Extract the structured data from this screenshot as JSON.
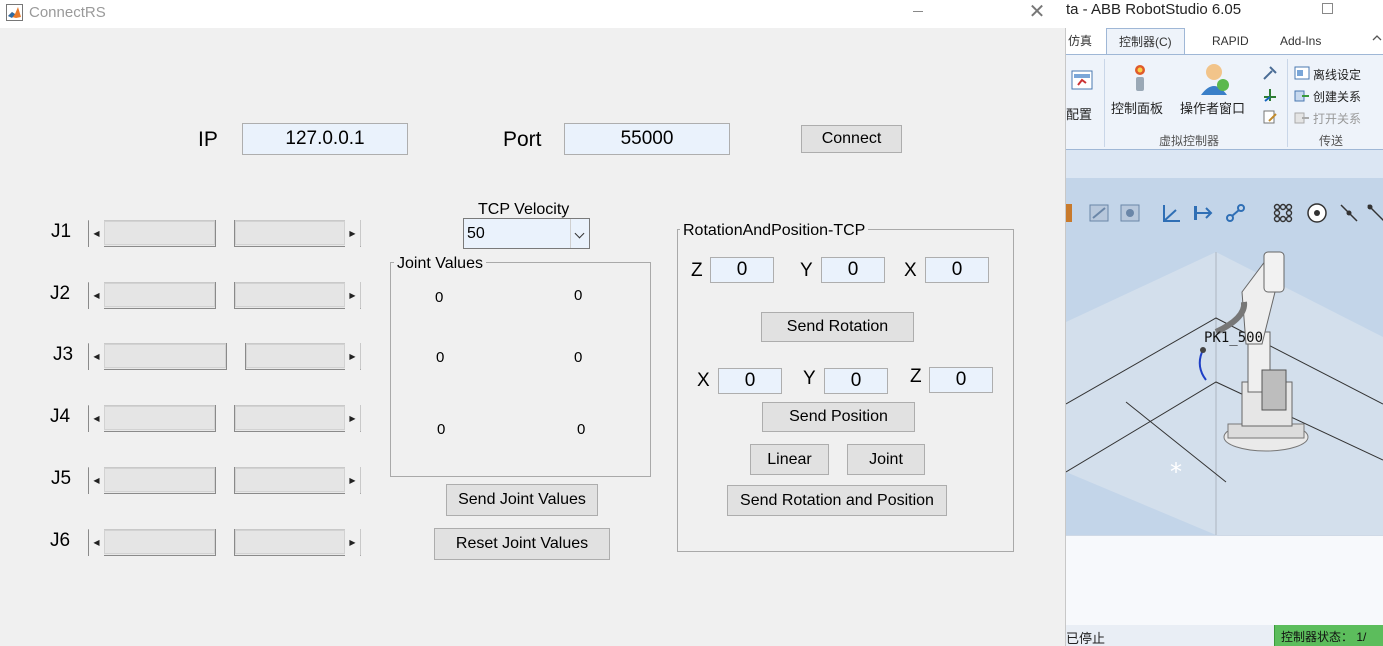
{
  "app": {
    "title": "ConnectRS",
    "close_glyph": "✕"
  },
  "connection": {
    "ip_label": "IP",
    "ip_value": "127.0.0.1",
    "port_label": "Port",
    "port_value": "55000",
    "connect_label": "Connect"
  },
  "joints": [
    {
      "label": "J1",
      "value": 0.5
    },
    {
      "label": "J2",
      "value": 0.5
    },
    {
      "label": "J3",
      "value": 0.55
    },
    {
      "label": "J4",
      "value": 0.5
    },
    {
      "label": "J5",
      "value": 0.5
    },
    {
      "label": "J6",
      "value": 0.5
    }
  ],
  "velocity": {
    "label": "TCP Velocity",
    "selected": "50"
  },
  "joint_values": {
    "title": "Joint Values",
    "values": [
      "0",
      "0",
      "0",
      "0",
      "0",
      "0"
    ],
    "send_label": "Send Joint Values",
    "reset_label": "Reset Joint Values"
  },
  "tcp": {
    "title": "RotationAndPosition-TCP",
    "rotation": {
      "z_label": "Z",
      "z_value": "0",
      "y_label": "Y",
      "y_value": "0",
      "x_label": "X",
      "x_value": "0"
    },
    "send_rotation_label": "Send Rotation",
    "position": {
      "x_label": "X",
      "x_value": "0",
      "y_label": "Y",
      "y_value": "0",
      "z_label": "Z",
      "z_value": "0"
    },
    "send_position_label": "Send Position",
    "linear_label": "Linear",
    "joint_label": "Joint",
    "send_both_label": "Send Rotation and Position"
  },
  "robotstudio": {
    "title": "ta - ABB RobotStudio 6.05",
    "tabs": [
      "仿真",
      "控制器(C)",
      "RAPID",
      "Add-Ins"
    ],
    "active_tab": "控制器(C)",
    "ribbon": {
      "config_label": "配置",
      "control_panel_label": "控制面板",
      "operator_window_label": "操作者窗口",
      "offline_settings_label": "离线设定",
      "create_relation_label": "创建关系",
      "open_relation_label": "打开关系",
      "group_virtual_controller": "虚拟控制器",
      "group_transfer": "传送"
    },
    "scene_label": "PK1_500",
    "status_left": "已停止",
    "status_right": "控制器状态： 1/"
  },
  "colors": {
    "window_bg": "#f0f0f0",
    "edit_bg": "#eaf2fc",
    "button_bg": "#e1e1e1",
    "viewport_bg": "#c3d5e9",
    "status_green": "#5cbd5c"
  }
}
